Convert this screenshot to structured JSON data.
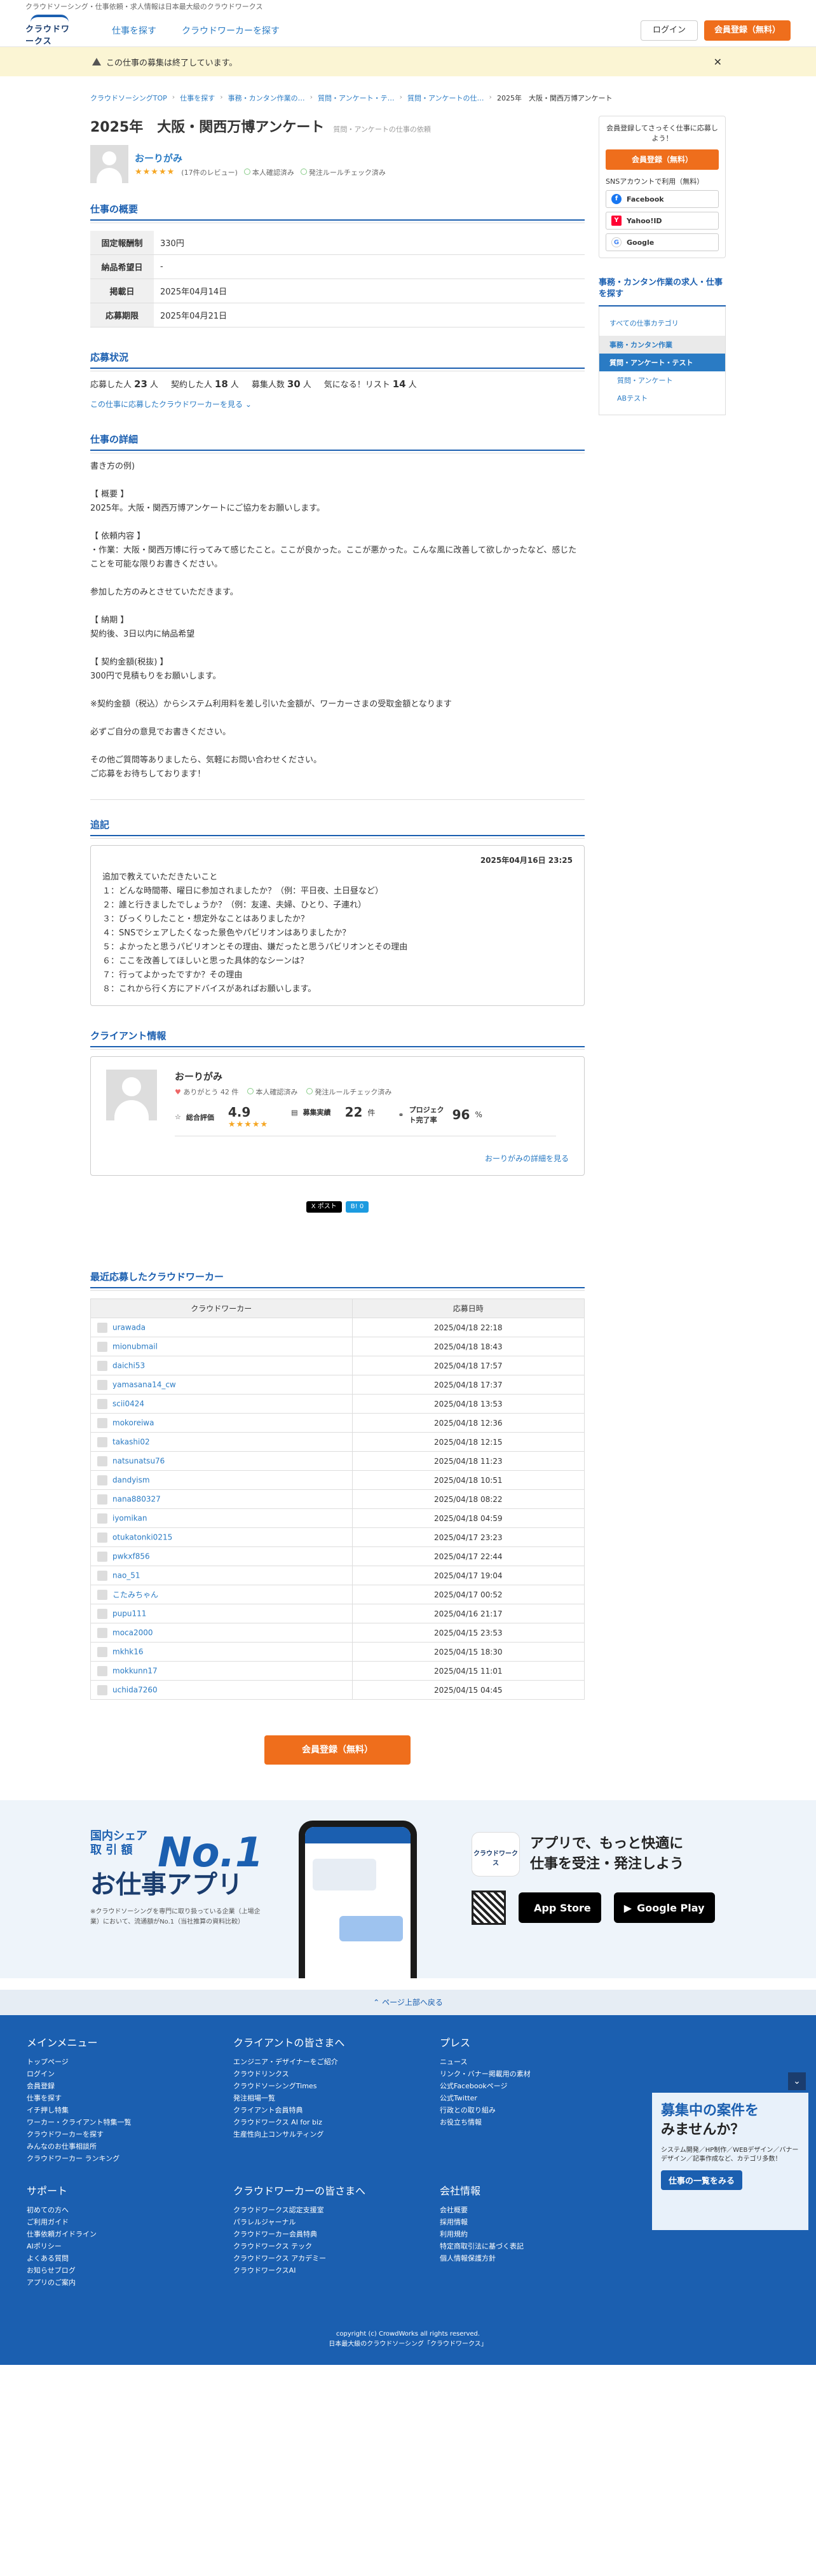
{
  "topline": "クラウドソーシング・仕事依頼・求人情報は日本最大級のクラウドワークス",
  "header": {
    "logo": "クラウドワークス",
    "nav": [
      "仕事を探す",
      "クラウドワーカーを探す"
    ],
    "login": "ログイン",
    "signup": "会員登録（無料）"
  },
  "notice": "この仕事の募集は終了しています。",
  "breadcrumb": [
    "クラウドソーシングTOP",
    "仕事を探す",
    "事務・カンタン作業の…",
    "質問・アンケート・テ…",
    "質問・アンケートの仕…",
    "2025年　大阪・関西万博アンケート"
  ],
  "job": {
    "title": "2025年　大阪・関西万博アンケート",
    "category": "質問・アンケートの仕事の依頼",
    "client_name": "おーりがみ",
    "rating_stars": "★★★★★",
    "reviews": "(17件のレビュー)",
    "verified": "本人確認済み",
    "rule_check": "発注ルールチェック済み"
  },
  "sections": {
    "summary": "仕事の概要",
    "status": "応募状況",
    "detail": "仕事の詳細",
    "addendum": "追記",
    "client": "クライアント情報",
    "recent": "最近応募したクラウドワーカー"
  },
  "summary_rows": [
    {
      "label": "固定報酬制",
      "value": "330円"
    },
    {
      "label": "納品希望日",
      "value": "-"
    },
    {
      "label": "掲載日",
      "value": "2025年04月14日"
    },
    {
      "label": "応募期限",
      "value": "2025年04月21日"
    }
  ],
  "status": {
    "applied_label": "応募した人",
    "applied": "23",
    "applied_unit": "人",
    "contracted_label": "契約した人",
    "contracted": "18",
    "contracted_unit": "人",
    "recruit_label": "募集人数",
    "recruit": "30",
    "recruit_unit": "人",
    "watch_label": "気になる！リスト",
    "watch": "14",
    "watch_unit": "人",
    "link": "この仕事に応募したクラウドワーカーを見る"
  },
  "detail_text": "書き方の例)\n\n【 概要 】\n2025年。大阪・関西万博アンケートにご協力をお願いします。\n\n【 依頼内容 】\n・作業：大阪・関西万博に行ってみて感じたこと。ここが良かった。ここが悪かった。こんな風に改善して欲しかったなど、感じたことを可能な限りお書きください。\n\n参加した方のみとさせていただきます。\n\n【 納期 】\n契約後、3日以内に納品希望\n\n【 契約金額(税抜) 】\n300円で見積もりをお願いします。\n\n※契約金額（税込）からシステム利用料を差し引いた金額が、ワーカーさまの受取金額となります\n\n必ずご自分の意見でお書きください。\n\nその他ご質問等ありましたら、気軽にお問い合わせください。\nご応募をお待ちしております！",
  "addendum": {
    "date": "2025年04月16日 23:25",
    "text": "追加で教えていただきたいこと\n１：どんな時間帯、曜日に参加されましたか？（例：平日夜、土日昼など）\n２：誰と行きましたでしょうか？（例：友達、夫婦、ひとり、子連れ）\n３：びっくりしたこと・想定外なことはありましたか？\n４：SNSでシェアしたくなった景色やパビリオンはありましたか？\n５：よかったと思うパビリオンとその理由、嫌だったと思うパビリオンとその理由\n６：ここを改善してほしいと思った具体的なシーンは？\n７：行ってよかったですか？その理由\n８：これから行く方にアドバイスがあればお願いします。"
  },
  "client_info": {
    "name": "おーりがみ",
    "thanks": "ありがとう 42 件",
    "verified": "本人確認済み",
    "rule_check": "発注ルールチェック済み",
    "rating_label": "総合評価",
    "rating": "4.9",
    "rating_stars": "★★★★★",
    "orders_label": "募集実績",
    "orders": "22",
    "orders_unit": "件",
    "completion_label": "プロジェクト完了率",
    "completion": "96",
    "completion_unit": "%",
    "more": "おーりがみの詳細を見る"
  },
  "share": {
    "x": "X ポスト",
    "b": "B! 0"
  },
  "workers_header": [
    "クラウドワーカー",
    "応募日時"
  ],
  "workers": [
    [
      "urawada",
      "2025/04/18 22:18"
    ],
    [
      "mionubmail",
      "2025/04/18 18:43"
    ],
    [
      "daichi53",
      "2025/04/18 17:57"
    ],
    [
      "yamasana14_cw",
      "2025/04/18 17:37"
    ],
    [
      "scii0424",
      "2025/04/18 13:53"
    ],
    [
      "mokoreiwa",
      "2025/04/18 12:36"
    ],
    [
      "takashi02",
      "2025/04/18 12:15"
    ],
    [
      "natsunatsu76",
      "2025/04/18 11:23"
    ],
    [
      "dandyism",
      "2025/04/18 10:51"
    ],
    [
      "nana880327",
      "2025/04/18 08:22"
    ],
    [
      "iyomikan",
      "2025/04/18 04:59"
    ],
    [
      "otukatonki0215",
      "2025/04/17 23:23"
    ],
    [
      "pwkxf856",
      "2025/04/17 22:44"
    ],
    [
      "nao_51",
      "2025/04/17 19:04"
    ],
    [
      "こたみちゃん",
      "2025/04/17 00:52"
    ],
    [
      "pupu111",
      "2025/04/16 21:17"
    ],
    [
      "moca2000",
      "2025/04/15 23:53"
    ],
    [
      "mkhk16",
      "2025/04/15 18:30"
    ],
    [
      "mokkunn17",
      "2025/04/15 11:01"
    ],
    [
      "uchida7260",
      "2025/04/15 04:45"
    ]
  ],
  "cta": "会員登録（無料）",
  "sidebar": {
    "intro": "会員登録してさっそく仕事に応募しよう！",
    "signup": "会員登録（無料）",
    "sns": "SNSアカウントで利用（無料）",
    "facebook": "Facebook",
    "yahoo": "Yahoo!ID",
    "google": "Google",
    "cat_title": "事務・カンタン作業の求人・仕事を探す",
    "all": "すべての仕事カテゴリ",
    "l1": "事務・カンタン作業",
    "l2": "質問・アンケート・テスト",
    "l3a": "質問・アンケート",
    "l3b": "ABテスト"
  },
  "app": {
    "t1a": "国内シェア",
    "t1b": "取 引 額",
    "no1": "No.1",
    "t2": "お仕事アプリ",
    "t3": "※クラウドソーシングを専門に取り扱っている企業（上場企業）において、流通額がNo.1（当社推算の資料比較）",
    "msg1": "アプリで、もっと快適に",
    "msg2": "仕事を受注・発注しよう",
    "icon": "クラウドワークス",
    "appstore": "App Store",
    "googleplay": "Google Play"
  },
  "pagetop": "ページ上部へ戻る",
  "footer": {
    "cols": [
      {
        "title": "メインメニュー",
        "items": [
          "トップページ",
          "ログイン",
          "会員登録",
          "仕事を探す",
          "イチ押し特集",
          "ワーカー・クライアント特集一覧",
          "クラウドワーカーを探す",
          "みんなのお仕事相談所",
          "クラウドワーカー ランキング"
        ]
      },
      {
        "title": "クライアントの皆さまへ",
        "items": [
          "エンジニア・デザイナーをご紹介",
          "クラウドリンクス",
          "クラウドソーシングTimes",
          "発注相場一覧",
          "クライアント会員特典",
          "クラウドワークス AI for biz",
          "生産性向上コンサルティング"
        ]
      },
      {
        "title": "プレス",
        "items": [
          "ニュース",
          "リンク・バナー掲載用の素材",
          "公式Facebookページ",
          "公式Twitter",
          "行政との取り組み",
          "お役立ち情報"
        ]
      },
      {
        "title": "サポート",
        "items": [
          "初めての方へ",
          "ご利用ガイド",
          "仕事依頼ガイドライン",
          "AIポリシー",
          "よくある質問",
          "お知らせブログ",
          "アプリのご案内"
        ]
      },
      {
        "title": "クラウドワーカーの皆さまへ",
        "items": [
          "クラウドワークス認定支援室",
          "パラレルジャーナル",
          "クラウドワーカー会員特典",
          "クラウドワークス テック",
          "クラウドワークス アカデミー",
          "クラウドワークスAI"
        ]
      },
      {
        "title": "会社情報",
        "items": [
          "会社概要",
          "採用情報",
          "利用規約",
          "特定商取引法に基づく表記",
          "個人情報保護方針"
        ]
      }
    ],
    "copy1": "copyright (c) CrowdWorks all rights reserved.",
    "copy2": "日本最大級のクラウドソーシング「クラウドワークス」"
  },
  "ad": {
    "t1": "募集中の案件を",
    "t2": "みませんか？",
    "sub": "システム開発／HP制作／WEBデザイン／バナーデザイン／記事作成など、カテゴリ多数！",
    "btn": "仕事の一覧をみる"
  }
}
